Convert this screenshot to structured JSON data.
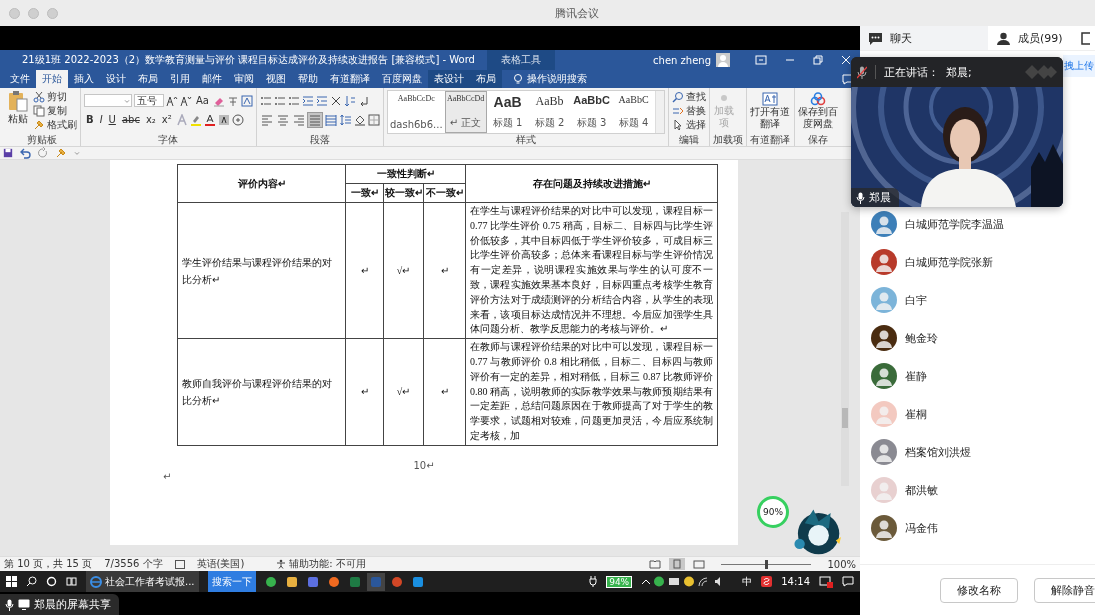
{
  "app_window": {
    "title": "腾讯会议"
  },
  "word": {
    "title": "21级1班 2022-2023（2）数学教育测量与评价 课程目标达成评价及持续改进报告 [兼容模式] - Word",
    "context_title": "表格工具",
    "user": "chen zheng",
    "tabs": [
      {
        "label": "文件",
        "selected": false,
        "kind": "normal"
      },
      {
        "label": "开始",
        "selected": true,
        "kind": "normal"
      },
      {
        "label": "插入",
        "selected": false,
        "kind": "normal"
      },
      {
        "label": "设计",
        "selected": false,
        "kind": "normal"
      },
      {
        "label": "布局",
        "selected": false,
        "kind": "normal"
      },
      {
        "label": "引用",
        "selected": false,
        "kind": "normal"
      },
      {
        "label": "邮件",
        "selected": false,
        "kind": "normal"
      },
      {
        "label": "审阅",
        "selected": false,
        "kind": "normal"
      },
      {
        "label": "视图",
        "selected": false,
        "kind": "normal"
      },
      {
        "label": "帮助",
        "selected": false,
        "kind": "normal"
      },
      {
        "label": "有道翻译",
        "selected": false,
        "kind": "normal"
      },
      {
        "label": "百度网盘",
        "selected": false,
        "kind": "normal"
      },
      {
        "label": "表设计",
        "selected": false,
        "kind": "context"
      },
      {
        "label": "布局",
        "selected": false,
        "kind": "context"
      }
    ],
    "tell_me": "操作说明搜索",
    "ribbon": {
      "clipboard": {
        "paste": "粘贴",
        "items": [
          "剪切",
          "复制",
          "格式刷"
        ],
        "label": "剪贴板"
      },
      "font": {
        "size": "五号",
        "case_button": "Aa",
        "format_buttons": [
          "B",
          "I",
          "U",
          "abc",
          "x₂",
          "x²"
        ],
        "label": "字体"
      },
      "paragraph": {
        "align_buttons": [
          {
            "selected": false
          },
          {
            "selected": false
          },
          {
            "selected": false
          },
          {
            "selected": true
          },
          {
            "selected": false
          }
        ],
        "label": "段落"
      },
      "styles": {
        "items": [
          {
            "preview": "AaBbCcDc",
            "name": "dash6b6...",
            "selected": false,
            "kind": "plain"
          },
          {
            "preview": "AaBbCcDd",
            "name": "↵ 正文",
            "selected": true,
            "kind": "plain"
          },
          {
            "preview": "AaB",
            "name": "标题 1",
            "selected": false,
            "kind": "h1"
          },
          {
            "preview": "AaBb",
            "name": "标题 2",
            "selected": false,
            "kind": "h2"
          },
          {
            "preview": "AaBbC",
            "name": "标题 3",
            "selected": false,
            "kind": "h3"
          },
          {
            "preview": "AaBbC",
            "name": "标题 4",
            "selected": false,
            "kind": "h4"
          }
        ],
        "label": "样式"
      },
      "editing": {
        "items": [
          "查找",
          "替换",
          "选择"
        ],
        "label": "编辑"
      },
      "addins": {
        "button": "加载项",
        "disabled": true,
        "label": "加载项"
      },
      "youdao": {
        "button": "打开有道翻译",
        "label": "有道翻译"
      },
      "save": {
        "button": "保存到百度网盘",
        "label": "保存"
      }
    },
    "document": {
      "table": {
        "headers": {
          "content": "评价内容↵",
          "judgement": "一致性判断↵",
          "levels": [
            "一致↵",
            "较一致↵",
            "不一致↵"
          ],
          "measures": "存在问题及持续改进措施↵"
        },
        "rows": [
          {
            "content": "学生评价结果与课程评价结果的对比分析↵",
            "marks": [
              "↵",
              "√↵",
              "↵"
            ],
            "measures": "在学生与课程评价结果的对比中可以发现，课程目标一 0.77 比学生评价 0.75 稍高，目标二、目标四与比学生评价低较多，其中目标四低于学生评价较多，可成目标三比学生评价高较多；总体来看课程目标与学生评价情况有一定差异，说明课程实施效果与学生的认可度不一致，课程实施效果基本良好，目标四重点考核学生教育评价方法对于成绩测评的分析结合内容，从学生的表现来看，该项目标达成情况并不理想。今后应加强学生具体问题分析、教学反思能力的考核与评价。↵"
          },
          {
            "content": "教师自我评价与课程评价结果的对比分析↵",
            "marks": [
              "↵",
              "√↵",
              "↵"
            ],
            "measures": "在教师与课程评价结果的对比中可以发现，课程目标一 0.77 与教师评价 0.8 相比稍低，目标二、目标四与教师评价有一定的差异，相对稍低，目标三 0.87 比教师评价 0.80 稍高，说明教师的实际教学效果与教师预期结果有一定差距，总结问题原因在于教师提高了对于学生的教学要求，试题相对较难，问题更加灵活，今后应系统制定考核，加"
          }
        ]
      },
      "page_number": "10↵",
      "trailing_mark": "↵"
    },
    "status_bar": {
      "page": "第 10 页，共 15 页",
      "words": "7/3556 个字",
      "language": "英语(美国)",
      "accessibility": "辅助功能: 不可用",
      "zoom_slider": {
        "level": 0.5
      },
      "zoom": "100%"
    }
  },
  "taskbar": {
    "window": "社会工作者考试报...",
    "search": "搜索一下",
    "battery": "94%",
    "ime": "中",
    "time": "14:14"
  },
  "monitor_widget": {
    "cpu": "90%"
  },
  "share_badge": "郑晨的屏幕共享",
  "side_panel": {
    "tabs": [
      {
        "label": "聊天",
        "selected": false
      },
      {
        "label": "成员(99)",
        "selected": true
      }
    ],
    "upload_hint": "拽上传",
    "speaker": {
      "mic_muted": true,
      "text": "正在讲话：  郑晨;"
    },
    "video": {
      "name": "郑晨"
    },
    "members": [
      {
        "name": "白城师范学院李温温"
      },
      {
        "name": "白城师范学院张新"
      },
      {
        "name": "白宇"
      },
      {
        "name": "鲍金玲"
      },
      {
        "name": "崔静"
      },
      {
        "name": "崔桐"
      },
      {
        "name": "档案馆刘洪煜"
      },
      {
        "name": "都洪敏"
      },
      {
        "name": "冯金伟"
      }
    ],
    "buttons": [
      "修改名称",
      "解除静音"
    ]
  }
}
